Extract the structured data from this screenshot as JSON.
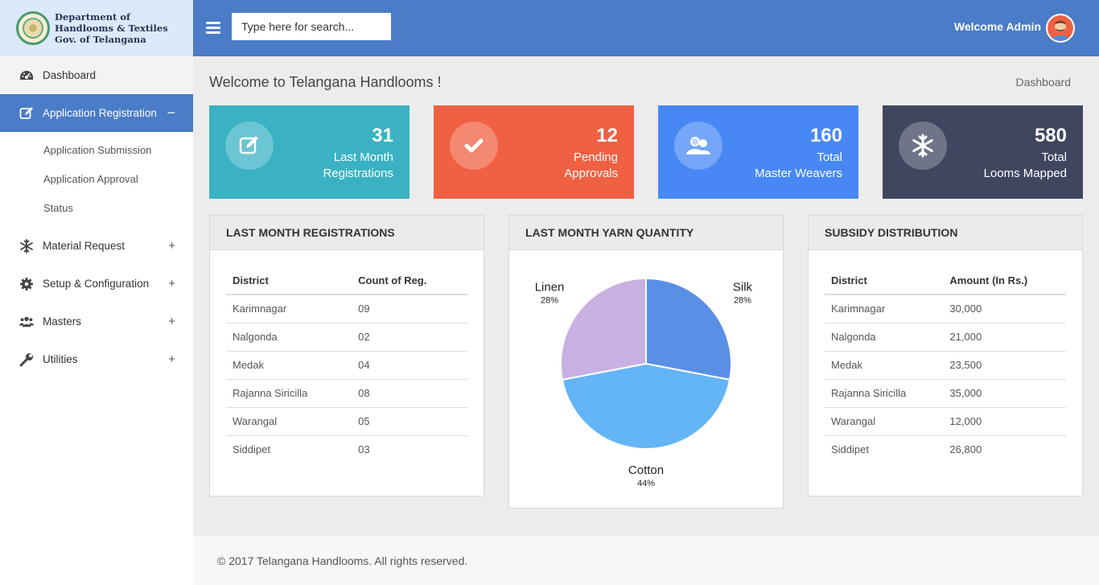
{
  "brand": {
    "line1": "Department of",
    "line2": "Handlooms & Textiles",
    "line3": "Gov. of Telangana"
  },
  "sidebar": {
    "items": [
      {
        "label": "Dashboard",
        "icon": "dashboard-icon"
      },
      {
        "label": "Application Registration",
        "icon": "edit-icon",
        "sign": "−"
      },
      {
        "label": "Material Request",
        "icon": "snowflake-icon",
        "sign": "+"
      },
      {
        "label": "Setup & Configuration",
        "icon": "gear-icon",
        "sign": "+"
      },
      {
        "label": "Masters",
        "icon": "users-icon",
        "sign": "+"
      },
      {
        "label": "Utilities",
        "icon": "wrench-icon",
        "sign": "+"
      }
    ],
    "subitems": [
      "Application Submission",
      "Application Approval",
      "Status"
    ]
  },
  "header": {
    "search_placeholder": "Type here for search...",
    "welcome": "Welcome Admin"
  },
  "main": {
    "title": "Welcome to Telangana Handlooms !",
    "breadcrumb": "Dashboard"
  },
  "stats": [
    {
      "value": "31",
      "line1": "Last Month",
      "line2": "Registrations",
      "color": "#3ab2c3"
    },
    {
      "value": "12",
      "line1": "Pending",
      "line2": "Approvals",
      "color": "#f06042"
    },
    {
      "value": "160",
      "line1": "Total",
      "line2": "Master Weavers",
      "color": "#4788f5"
    },
    {
      "value": "580",
      "line1": "Total",
      "line2": "Looms Mapped",
      "color": "#404660"
    }
  ],
  "registrations": {
    "title": "LAST MONTH REGISTRATIONS",
    "headers": [
      "District",
      "Count of Reg."
    ],
    "rows": [
      [
        "Karimnagar",
        "09"
      ],
      [
        "Nalgonda",
        "02"
      ],
      [
        "Medak",
        "04"
      ],
      [
        "Rajanna Siricilla",
        "08"
      ],
      [
        "Warangal",
        "05"
      ],
      [
        "Siddipet",
        "03"
      ]
    ]
  },
  "yarn": {
    "title": "LAST MONTH YARN QUANTITY"
  },
  "chart_data": {
    "type": "pie",
    "categories": [
      "Silk",
      "Cotton",
      "Linen"
    ],
    "values": [
      28,
      44,
      28
    ],
    "labels": [
      "28%",
      "44%",
      "28%"
    ],
    "colors": [
      "#5a8fe6",
      "#64b5f6",
      "#c8b0e2"
    ]
  },
  "subsidy": {
    "title": "SUBSIDY DISTRIBUTION",
    "headers": [
      "District",
      "Amount (In Rs.)"
    ],
    "rows": [
      [
        "Karimnagar",
        "30,000"
      ],
      [
        "Nalgonda",
        "21,000"
      ],
      [
        "Medak",
        "23,500"
      ],
      [
        "Rajanna Siricilla",
        "35,000"
      ],
      [
        "Warangal",
        "12,000"
      ],
      [
        "Siddipet",
        "26,800"
      ]
    ]
  },
  "footer": {
    "text": "© 2017 Telangana Handlooms. All rights reserved."
  }
}
